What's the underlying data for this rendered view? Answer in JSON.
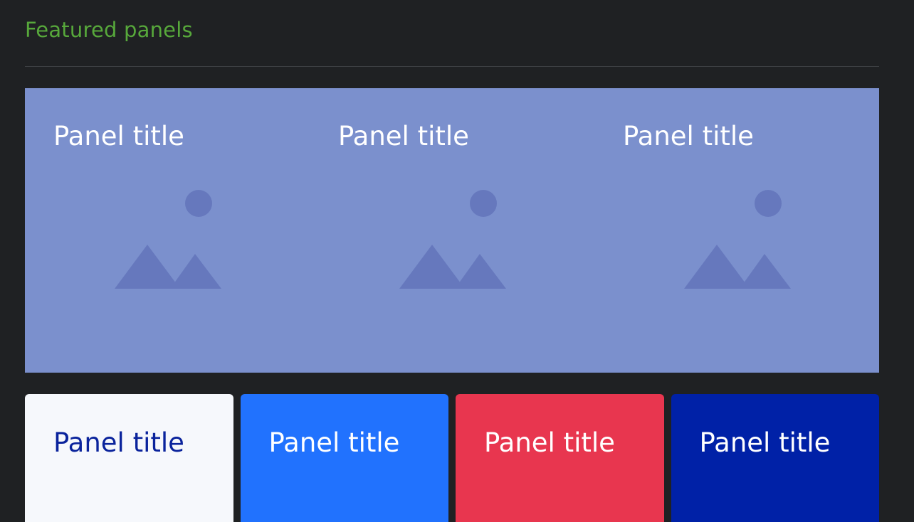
{
  "section": {
    "title": "Featured panels",
    "title_color": "#57a83b"
  },
  "colors": {
    "background": "#1f2123",
    "divider": "#3c3f42",
    "hero_background": "#7b90cd",
    "hero_icon": "#6678bd"
  },
  "hero_panels": [
    {
      "title": "Panel title",
      "icon": "image-placeholder-icon"
    },
    {
      "title": "Panel title",
      "icon": "image-placeholder-icon"
    },
    {
      "title": "Panel title",
      "icon": "image-placeholder-icon"
    }
  ],
  "cards": [
    {
      "title": "Panel title",
      "background": "#f6f8fc",
      "text_color": "#0a239c"
    },
    {
      "title": "Panel title",
      "background": "#2172fe",
      "text_color": "#ffffff"
    },
    {
      "title": "Panel title",
      "background": "#e8364f",
      "text_color": "#ffffff"
    },
    {
      "title": "Panel title",
      "background": "#0021a7",
      "text_color": "#ffffff"
    }
  ]
}
